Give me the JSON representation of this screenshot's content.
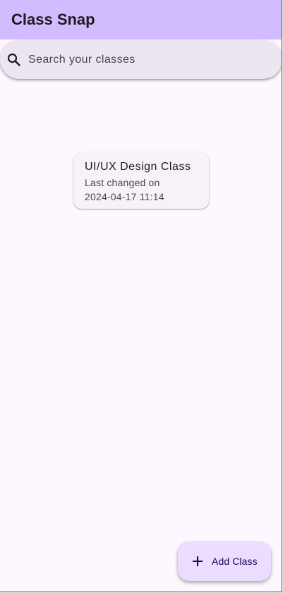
{
  "app_bar": {
    "title": "Class Snap",
    "background": "#d0bcff"
  },
  "search": {
    "placeholder": "Search your classes",
    "value": "",
    "icon": "search-icon"
  },
  "classes": [
    {
      "title": "UI/UX Design Class",
      "subtitle": "Last changed on 2024-04-17 11:14"
    }
  ],
  "fab": {
    "label": "Add Class",
    "icon": "plus-icon",
    "background": "#eaddff"
  },
  "colors": {
    "surface": "#fef7ff",
    "card": "#f7f2fa",
    "search_bar": "#ece6f0",
    "on_surface": "#1d1b20"
  }
}
